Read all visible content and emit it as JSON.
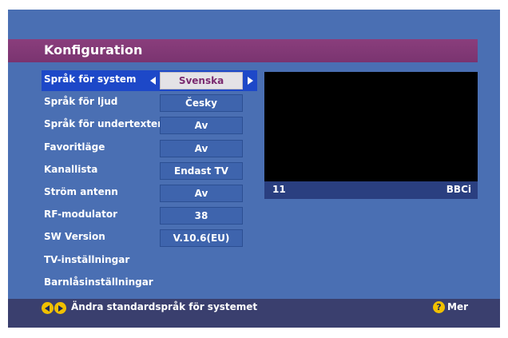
{
  "header": {
    "title": "Konfiguration"
  },
  "menu": {
    "items": [
      {
        "label": "Språk för system",
        "value": "Svenska"
      },
      {
        "label": "Språk för ljud",
        "value": "Česky"
      },
      {
        "label": "Språk för undertexter",
        "value": "Av"
      },
      {
        "label": "Favoritläge",
        "value": "Av"
      },
      {
        "label": "Kanallista",
        "value": "Endast TV"
      },
      {
        "label": "Ström antenn",
        "value": "Av"
      },
      {
        "label": "RF-modulator",
        "value": "38"
      },
      {
        "label": "SW Version",
        "value": "V.10.6(EU)"
      },
      {
        "label": "TV-inställningar"
      },
      {
        "label": "Barnlåsinställningar"
      }
    ],
    "selected_index": 0
  },
  "preview": {
    "channel_number": "11",
    "channel_name": "BBCi"
  },
  "footer": {
    "hint": "Ändra standardspråk för systemet",
    "help_symbol": "?",
    "help_label": "Mer"
  },
  "colors": {
    "background": "#4a6fb3",
    "title_bar": "#8a3e7c",
    "selection": "#1d48c8",
    "footer": "#3a3f6e",
    "button_yellow": "#f0c000"
  },
  "icons": [
    "arrow-left-icon",
    "arrow-right-icon",
    "left-button-icon",
    "right-button-icon",
    "help-icon"
  ]
}
